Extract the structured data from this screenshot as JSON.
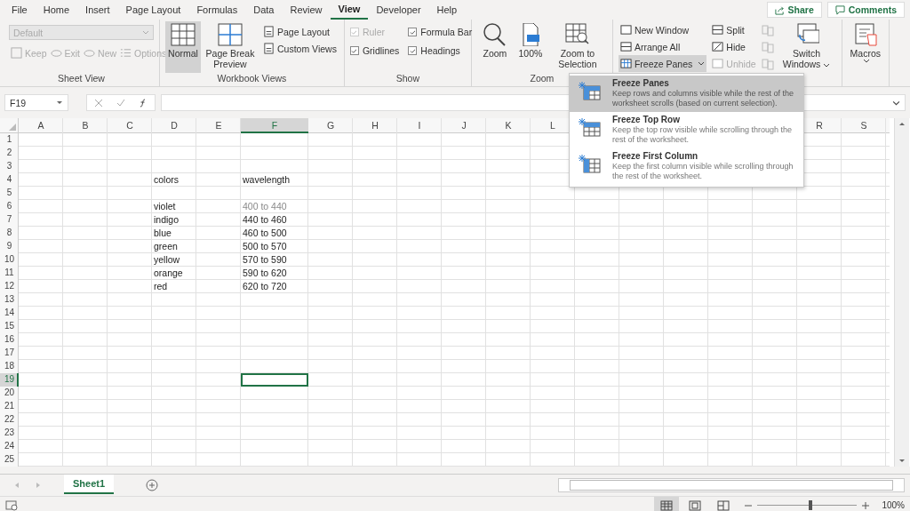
{
  "menu_tabs": [
    {
      "label": "File",
      "selected": false
    },
    {
      "label": "Home",
      "selected": false
    },
    {
      "label": "Insert",
      "selected": false
    },
    {
      "label": "Page Layout",
      "selected": false
    },
    {
      "label": "Formulas",
      "selected": false
    },
    {
      "label": "Data",
      "selected": false
    },
    {
      "label": "Review",
      "selected": false
    },
    {
      "label": "View",
      "selected": true
    },
    {
      "label": "Developer",
      "selected": false
    },
    {
      "label": "Help",
      "selected": false
    }
  ],
  "share_button": "Share",
  "comments_button": "Comments",
  "ribbon": {
    "groups": [
      {
        "kind": "sheet_view",
        "label": "Sheet View",
        "dropdown": {
          "value": "Default",
          "disabled": true
        },
        "buttons": [
          {
            "label": "Keep",
            "disabled": true
          },
          {
            "label": "Exit",
            "disabled": true
          },
          {
            "label": "New",
            "disabled": true
          },
          {
            "label": "Options",
            "disabled": true
          }
        ]
      },
      {
        "kind": "workbook_views",
        "label": "Workbook Views",
        "large": [
          {
            "label": "Normal",
            "selected": true
          },
          {
            "label": "Page Break Preview",
            "selected": false
          }
        ],
        "small": [
          {
            "label": "Page Layout"
          },
          {
            "label": "Custom Views"
          }
        ]
      },
      {
        "kind": "show",
        "label": "Show",
        "checks": [
          {
            "label": "Ruler",
            "checked": true,
            "disabled": true
          },
          {
            "label": "Formula Bar",
            "checked": true,
            "disabled": false
          },
          {
            "label": "Gridlines",
            "checked": true,
            "disabled": false
          },
          {
            "label": "Headings",
            "checked": true,
            "disabled": false
          }
        ]
      },
      {
        "kind": "zoom",
        "label": "Zoom",
        "large": [
          {
            "label": "Zoom"
          },
          {
            "label": "100%"
          },
          {
            "label": "Zoom to Selection"
          }
        ]
      },
      {
        "kind": "window",
        "small": [
          {
            "label": "New Window",
            "disabled": false,
            "open": false
          },
          {
            "label": "Arrange All",
            "disabled": false,
            "open": false
          },
          {
            "label": "Freeze Panes",
            "disabled": false,
            "open": true
          },
          {
            "label": "Split",
            "disabled": false,
            "open": false
          },
          {
            "label": "Hide",
            "disabled": false,
            "open": false
          },
          {
            "label": "Unhide",
            "disabled": true,
            "open": false
          }
        ],
        "icon_buttons": [
          {
            "disabled": true
          },
          {
            "disabled": true
          },
          {
            "disabled": true
          }
        ],
        "large": [
          {
            "label": "Switch Windows"
          }
        ]
      },
      {
        "kind": "macros",
        "large": [
          {
            "label": "Macros"
          }
        ]
      }
    ]
  },
  "freeze_menu": [
    {
      "title": "Freeze Panes",
      "description": "Keep rows and columns visible while the rest of the worksheet scrolls (based on current selection).",
      "selected": true
    },
    {
      "title": "Freeze Top Row",
      "description": "Keep the top row visible while scrolling through the rest of the worksheet.",
      "selected": false
    },
    {
      "title": "Freeze First Column",
      "description": "Keep the first column visible while scrolling through the rest of the worksheet.",
      "selected": false
    }
  ],
  "name_box": "F19",
  "columns": [
    {
      "label": "A",
      "selected": false
    },
    {
      "label": "B",
      "selected": false
    },
    {
      "label": "C",
      "selected": false
    },
    {
      "label": "D",
      "selected": false
    },
    {
      "label": "E",
      "selected": false
    },
    {
      "label": "F",
      "selected": true
    },
    {
      "label": "G",
      "selected": false
    },
    {
      "label": "H",
      "selected": false
    },
    {
      "label": "I",
      "selected": false
    },
    {
      "label": "J",
      "selected": false
    },
    {
      "label": "K",
      "selected": false
    },
    {
      "label": "L",
      "selected": false
    },
    null,
    null,
    null,
    null,
    null,
    {
      "label": "R",
      "selected": false
    },
    {
      "label": "S",
      "selected": false
    }
  ],
  "rows": [
    {
      "number": "1",
      "selected": false
    },
    {
      "number": "2",
      "selected": false
    },
    {
      "number": "3",
      "selected": false
    },
    {
      "number": "4",
      "selected": false,
      "cells": [
        null,
        null,
        null,
        {
          "text": "colors",
          "muted": false
        },
        null,
        {
          "text": "wavelength",
          "muted": false
        }
      ]
    },
    {
      "number": "5",
      "selected": false
    },
    {
      "number": "6",
      "selected": false,
      "cells": [
        null,
        null,
        null,
        {
          "text": "violet",
          "muted": false
        },
        null,
        {
          "text": "400 to 440",
          "muted": true
        }
      ]
    },
    {
      "number": "7",
      "selected": false,
      "cells": [
        null,
        null,
        null,
        {
          "text": "indigo",
          "muted": false
        },
        null,
        {
          "text": "440 to 460",
          "muted": false
        }
      ]
    },
    {
      "number": "8",
      "selected": false,
      "cells": [
        null,
        null,
        null,
        {
          "text": "blue",
          "muted": false
        },
        null,
        {
          "text": "460 to 500",
          "muted": false
        }
      ]
    },
    {
      "number": "9",
      "selected": false,
      "cells": [
        null,
        null,
        null,
        {
          "text": "green",
          "muted": false
        },
        null,
        {
          "text": "500 to 570",
          "muted": false
        }
      ]
    },
    {
      "number": "10",
      "selected": false,
      "cells": [
        null,
        null,
        null,
        {
          "text": "yellow",
          "muted": false
        },
        null,
        {
          "text": "570 to 590",
          "muted": false
        }
      ]
    },
    {
      "number": "11",
      "selected": false,
      "cells": [
        null,
        null,
        null,
        {
          "text": "orange",
          "muted": false
        },
        null,
        {
          "text": "590 to 620",
          "muted": false
        }
      ]
    },
    {
      "number": "12",
      "selected": false,
      "cells": [
        null,
        null,
        null,
        {
          "text": "red",
          "muted": false
        },
        null,
        {
          "text": "620 to 720",
          "muted": false
        }
      ]
    },
    {
      "number": "13",
      "selected": false
    },
    {
      "number": "14",
      "selected": false
    },
    {
      "number": "15",
      "selected": false
    },
    {
      "number": "16",
      "selected": false
    },
    {
      "number": "17",
      "selected": false
    },
    {
      "number": "18",
      "selected": false
    },
    {
      "number": "19",
      "selected": true
    },
    {
      "number": "20",
      "selected": false
    },
    {
      "number": "21",
      "selected": false
    },
    {
      "number": "22",
      "selected": false
    },
    {
      "number": "23",
      "selected": false
    },
    {
      "number": "24",
      "selected": false
    },
    {
      "number": "25",
      "selected": false
    }
  ],
  "sheet_tabs": [
    {
      "label": "Sheet1",
      "selected": true
    }
  ],
  "status_bar": {
    "views": [
      {
        "selected": true
      },
      {
        "selected": false
      },
      {
        "selected": false
      }
    ],
    "zoom": {
      "level": 0.53,
      "reading": "100%"
    }
  }
}
